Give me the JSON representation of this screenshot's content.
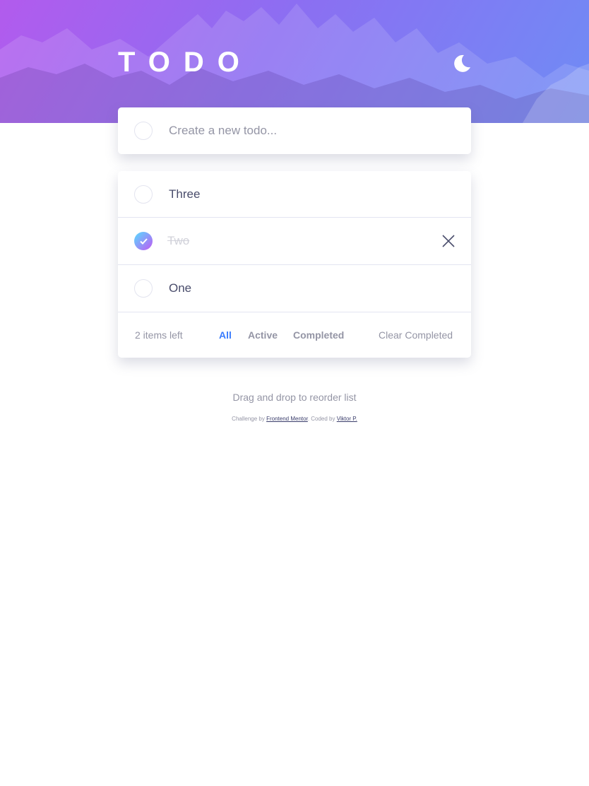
{
  "header": {
    "title": "TODO",
    "theme_toggle_icon": "moon-icon"
  },
  "new_todo": {
    "placeholder": "Create a new todo...",
    "value": ""
  },
  "todos": [
    {
      "label": "Three",
      "completed": false
    },
    {
      "label": "Two",
      "completed": true
    },
    {
      "label": "One",
      "completed": false
    }
  ],
  "footer": {
    "items_left": "2 items left",
    "filters": [
      "All",
      "Active",
      "Completed"
    ],
    "active_filter": "All",
    "clear_label": "Clear Completed"
  },
  "hint": "Drag and drop to reorder list",
  "attribution": {
    "challenge_prefix": "Challenge by",
    "challenge_link": "Frontend Mentor",
    "coded_prefix": ". Coded by",
    "coded_link": "Viktor P.",
    "suffix": "."
  },
  "colors": {
    "accent": "#3a7cfd",
    "check_gradient_start": "#57ddff",
    "check_gradient_end": "#c058f3",
    "text": "#494c6b",
    "muted": "#9495a5"
  }
}
